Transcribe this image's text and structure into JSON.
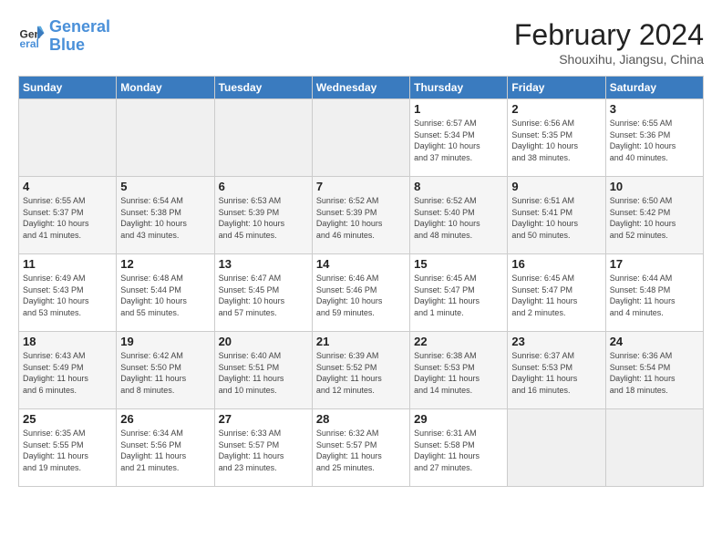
{
  "header": {
    "logo_line1": "General",
    "logo_line2": "Blue",
    "month_year": "February 2024",
    "location": "Shouxihu, Jiangsu, China"
  },
  "weekdays": [
    "Sunday",
    "Monday",
    "Tuesday",
    "Wednesday",
    "Thursday",
    "Friday",
    "Saturday"
  ],
  "weeks": [
    [
      {
        "day": "",
        "info": ""
      },
      {
        "day": "",
        "info": ""
      },
      {
        "day": "",
        "info": ""
      },
      {
        "day": "",
        "info": ""
      },
      {
        "day": "1",
        "info": "Sunrise: 6:57 AM\nSunset: 5:34 PM\nDaylight: 10 hours\nand 37 minutes."
      },
      {
        "day": "2",
        "info": "Sunrise: 6:56 AM\nSunset: 5:35 PM\nDaylight: 10 hours\nand 38 minutes."
      },
      {
        "day": "3",
        "info": "Sunrise: 6:55 AM\nSunset: 5:36 PM\nDaylight: 10 hours\nand 40 minutes."
      }
    ],
    [
      {
        "day": "4",
        "info": "Sunrise: 6:55 AM\nSunset: 5:37 PM\nDaylight: 10 hours\nand 41 minutes."
      },
      {
        "day": "5",
        "info": "Sunrise: 6:54 AM\nSunset: 5:38 PM\nDaylight: 10 hours\nand 43 minutes."
      },
      {
        "day": "6",
        "info": "Sunrise: 6:53 AM\nSunset: 5:39 PM\nDaylight: 10 hours\nand 45 minutes."
      },
      {
        "day": "7",
        "info": "Sunrise: 6:52 AM\nSunset: 5:39 PM\nDaylight: 10 hours\nand 46 minutes."
      },
      {
        "day": "8",
        "info": "Sunrise: 6:52 AM\nSunset: 5:40 PM\nDaylight: 10 hours\nand 48 minutes."
      },
      {
        "day": "9",
        "info": "Sunrise: 6:51 AM\nSunset: 5:41 PM\nDaylight: 10 hours\nand 50 minutes."
      },
      {
        "day": "10",
        "info": "Sunrise: 6:50 AM\nSunset: 5:42 PM\nDaylight: 10 hours\nand 52 minutes."
      }
    ],
    [
      {
        "day": "11",
        "info": "Sunrise: 6:49 AM\nSunset: 5:43 PM\nDaylight: 10 hours\nand 53 minutes."
      },
      {
        "day": "12",
        "info": "Sunrise: 6:48 AM\nSunset: 5:44 PM\nDaylight: 10 hours\nand 55 minutes."
      },
      {
        "day": "13",
        "info": "Sunrise: 6:47 AM\nSunset: 5:45 PM\nDaylight: 10 hours\nand 57 minutes."
      },
      {
        "day": "14",
        "info": "Sunrise: 6:46 AM\nSunset: 5:46 PM\nDaylight: 10 hours\nand 59 minutes."
      },
      {
        "day": "15",
        "info": "Sunrise: 6:45 AM\nSunset: 5:47 PM\nDaylight: 11 hours\nand 1 minute."
      },
      {
        "day": "16",
        "info": "Sunrise: 6:45 AM\nSunset: 5:47 PM\nDaylight: 11 hours\nand 2 minutes."
      },
      {
        "day": "17",
        "info": "Sunrise: 6:44 AM\nSunset: 5:48 PM\nDaylight: 11 hours\nand 4 minutes."
      }
    ],
    [
      {
        "day": "18",
        "info": "Sunrise: 6:43 AM\nSunset: 5:49 PM\nDaylight: 11 hours\nand 6 minutes."
      },
      {
        "day": "19",
        "info": "Sunrise: 6:42 AM\nSunset: 5:50 PM\nDaylight: 11 hours\nand 8 minutes."
      },
      {
        "day": "20",
        "info": "Sunrise: 6:40 AM\nSunset: 5:51 PM\nDaylight: 11 hours\nand 10 minutes."
      },
      {
        "day": "21",
        "info": "Sunrise: 6:39 AM\nSunset: 5:52 PM\nDaylight: 11 hours\nand 12 minutes."
      },
      {
        "day": "22",
        "info": "Sunrise: 6:38 AM\nSunset: 5:53 PM\nDaylight: 11 hours\nand 14 minutes."
      },
      {
        "day": "23",
        "info": "Sunrise: 6:37 AM\nSunset: 5:53 PM\nDaylight: 11 hours\nand 16 minutes."
      },
      {
        "day": "24",
        "info": "Sunrise: 6:36 AM\nSunset: 5:54 PM\nDaylight: 11 hours\nand 18 minutes."
      }
    ],
    [
      {
        "day": "25",
        "info": "Sunrise: 6:35 AM\nSunset: 5:55 PM\nDaylight: 11 hours\nand 19 minutes."
      },
      {
        "day": "26",
        "info": "Sunrise: 6:34 AM\nSunset: 5:56 PM\nDaylight: 11 hours\nand 21 minutes."
      },
      {
        "day": "27",
        "info": "Sunrise: 6:33 AM\nSunset: 5:57 PM\nDaylight: 11 hours\nand 23 minutes."
      },
      {
        "day": "28",
        "info": "Sunrise: 6:32 AM\nSunset: 5:57 PM\nDaylight: 11 hours\nand 25 minutes."
      },
      {
        "day": "29",
        "info": "Sunrise: 6:31 AM\nSunset: 5:58 PM\nDaylight: 11 hours\nand 27 minutes."
      },
      {
        "day": "",
        "info": ""
      },
      {
        "day": "",
        "info": ""
      }
    ]
  ]
}
